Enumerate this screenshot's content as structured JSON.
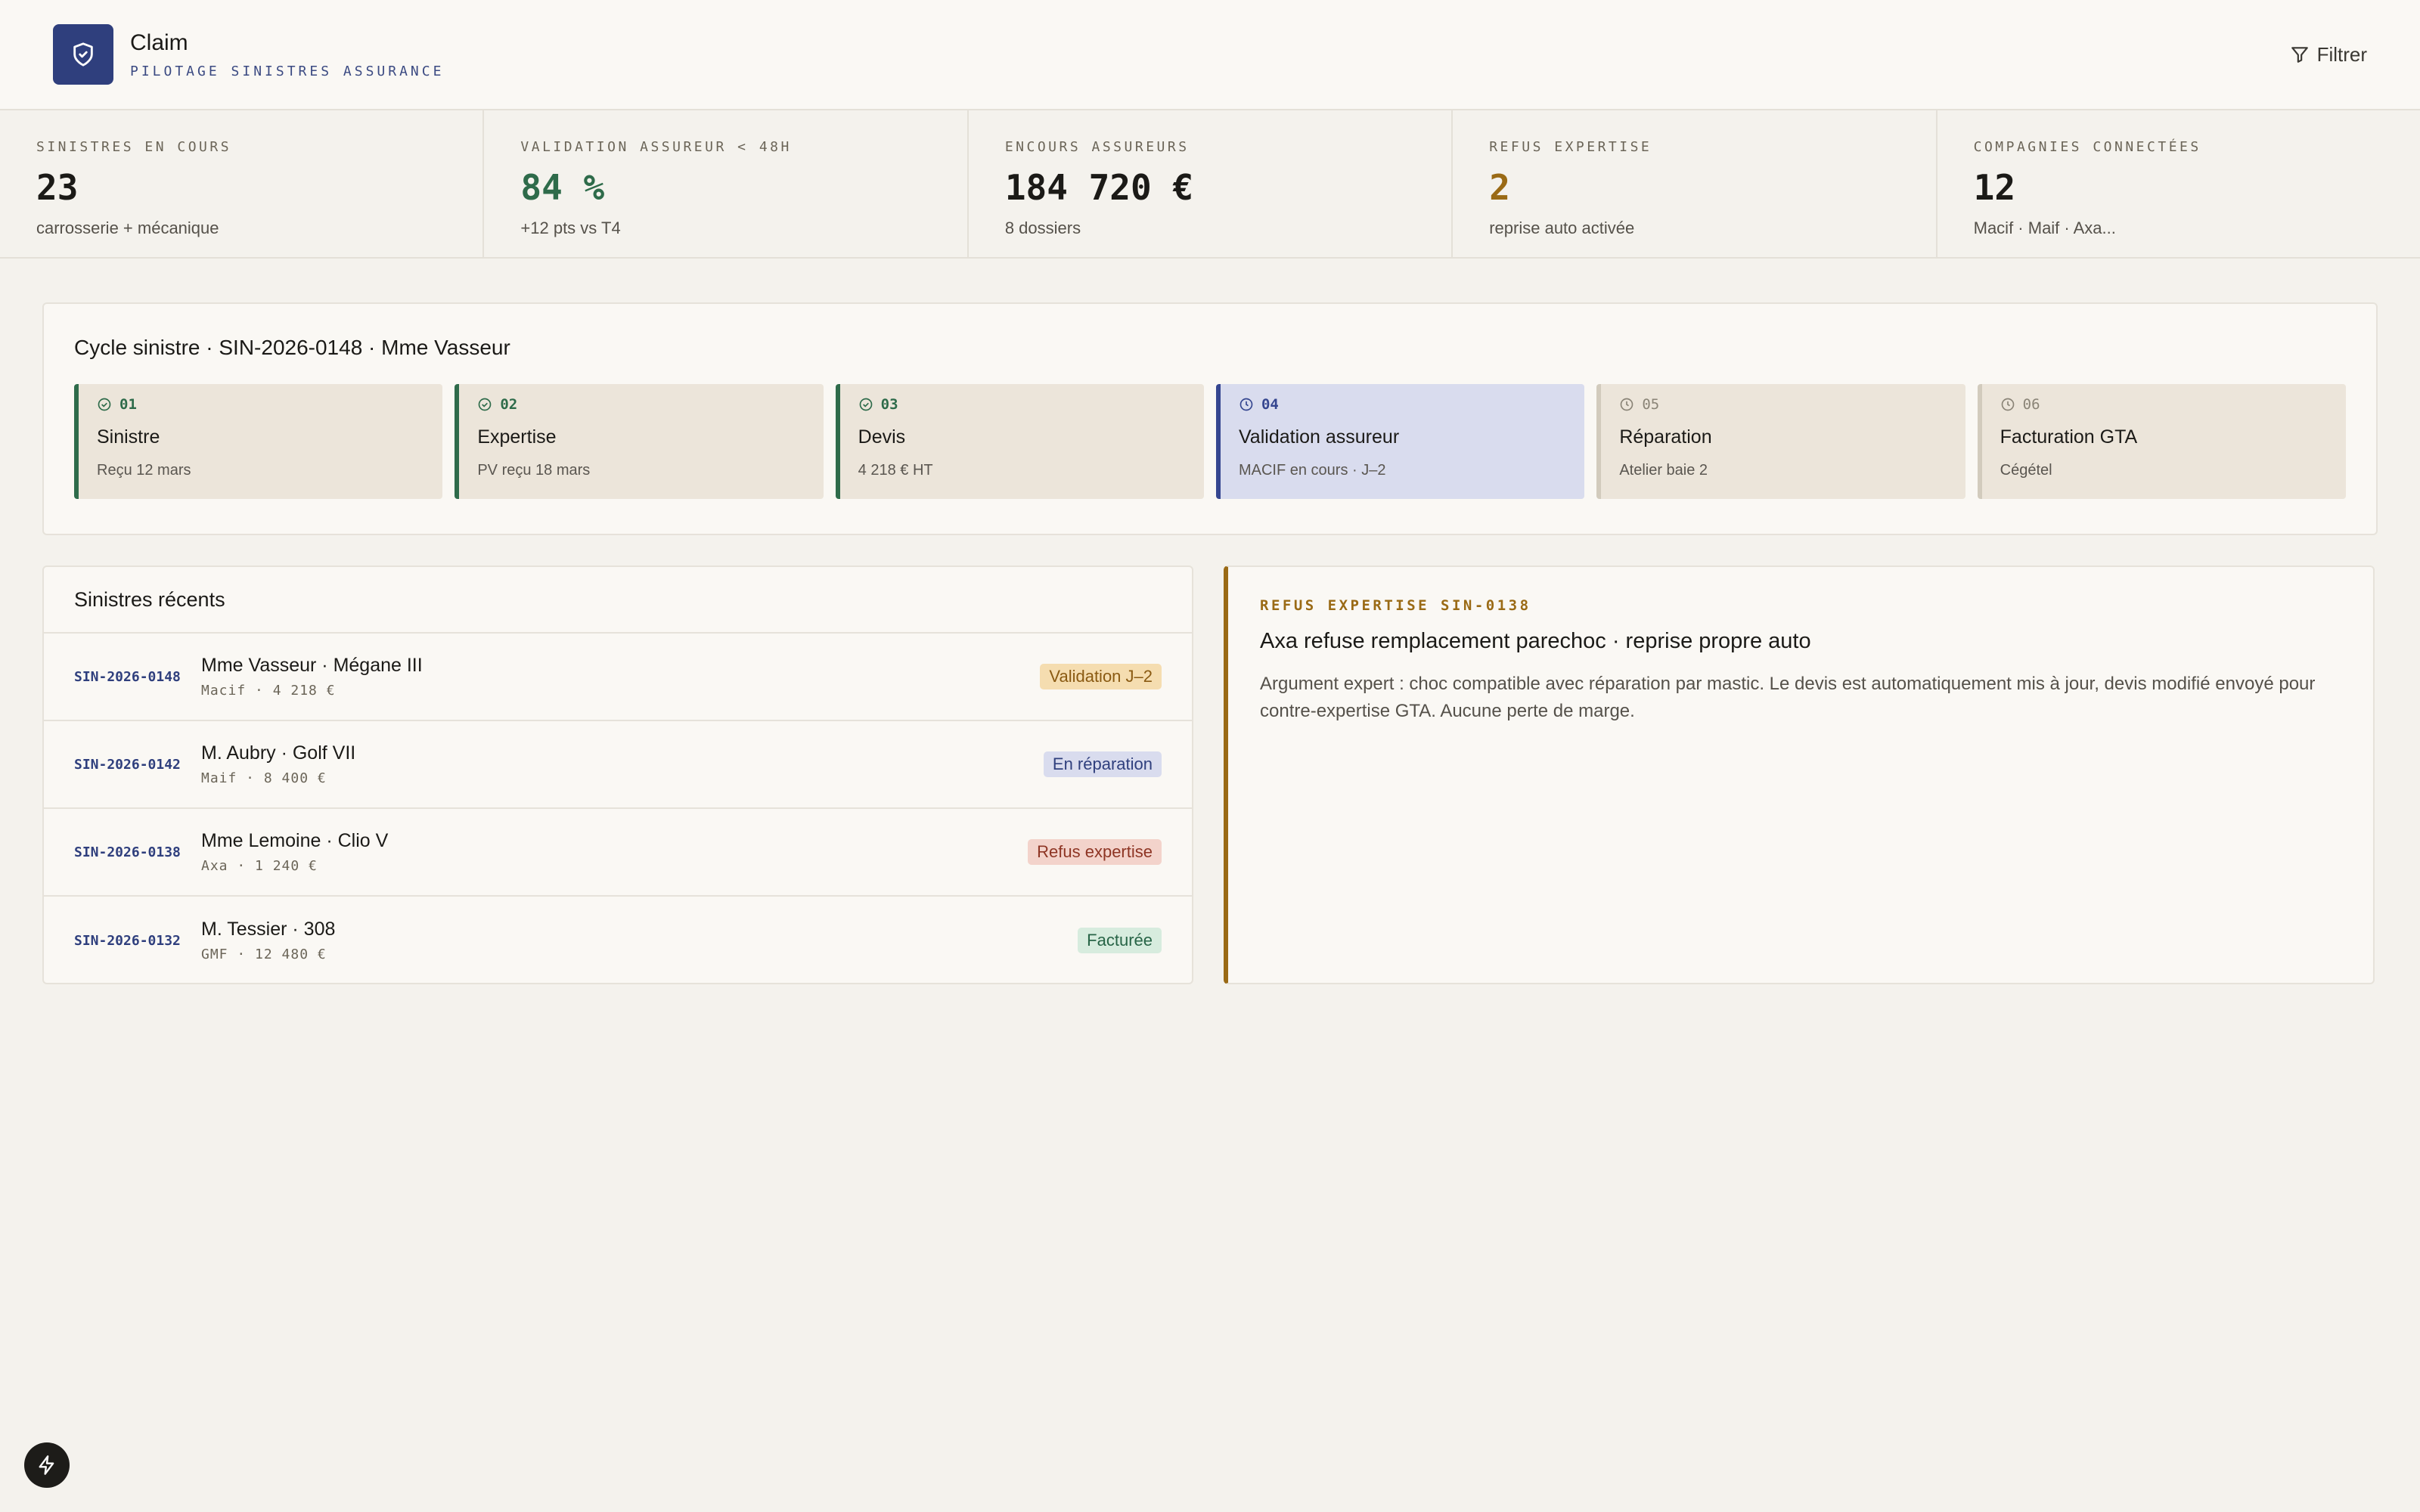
{
  "app": {
    "title": "Claim",
    "subtitle": "PILOTAGE SINISTRES ASSURANCE",
    "filter_label": "Filtrer"
  },
  "kpis": [
    {
      "label": "SINISTRES EN COURS",
      "value": "23",
      "note": "carrosserie + mécanique",
      "color": "#1b1a17"
    },
    {
      "label": "VALIDATION ASSUREUR < 48H",
      "value": "84 %",
      "note": "+12 pts vs T4",
      "color": "#2e6b4a"
    },
    {
      "label": "ENCOURS ASSUREURS",
      "value": "184 720 €",
      "note": "8 dossiers",
      "color": "#1b1a17"
    },
    {
      "label": "REFUS EXPERTISE",
      "value": "2",
      "note": "reprise auto activée",
      "color": "#9a6a15"
    },
    {
      "label": "COMPAGNIES CONNECTÉES",
      "value": "12",
      "note": "Macif · Maif · Axa...",
      "color": "#1b1a17"
    }
  ],
  "cycle": {
    "title": "Cycle sinistre · SIN-2026-0148 · Mme Vasseur",
    "steps": [
      {
        "num": "01",
        "name": "Sinistre",
        "info": "Reçu 12 mars",
        "state": "done"
      },
      {
        "num": "02",
        "name": "Expertise",
        "info": "PV reçu 18 mars",
        "state": "done"
      },
      {
        "num": "03",
        "name": "Devis",
        "info": "4 218 € HT",
        "state": "done"
      },
      {
        "num": "04",
        "name": "Validation assureur",
        "info": "MACIF en cours · J–2",
        "state": "current"
      },
      {
        "num": "05",
        "name": "Réparation",
        "info": "Atelier baie 2",
        "state": "pending"
      },
      {
        "num": "06",
        "name": "Facturation GTA",
        "info": "Cégétel",
        "state": "pending"
      }
    ]
  },
  "recent": {
    "title": "Sinistres récents",
    "rows": [
      {
        "id": "SIN-2026-0148",
        "name": "Mme Vasseur · Mégane III",
        "meta": "Macif · 4 218 €",
        "status": "Validation J–2",
        "tone": "amber"
      },
      {
        "id": "SIN-2026-0142",
        "name": "M. Aubry · Golf VII",
        "meta": "Maif · 8 400 €",
        "status": "En réparation",
        "tone": "blue"
      },
      {
        "id": "SIN-2026-0138",
        "name": "Mme Lemoine · Clio V",
        "meta": "Axa · 1 240 €",
        "status": "Refus expertise",
        "tone": "red"
      },
      {
        "id": "SIN-2026-0132",
        "name": "M. Tessier · 308",
        "meta": "GMF · 12 480 €",
        "status": "Facturée",
        "tone": "green"
      }
    ]
  },
  "alert": {
    "label": "REFUS EXPERTISE SIN-0138",
    "title": "Axa refuse remplacement parechoc · reprise propre auto",
    "body": "Argument expert : choc compatible avec réparation par mastic. Le devis est automatiquement mis à jour, devis modifié envoyé pour contre-expertise GTA. Aucune perte de marge."
  }
}
